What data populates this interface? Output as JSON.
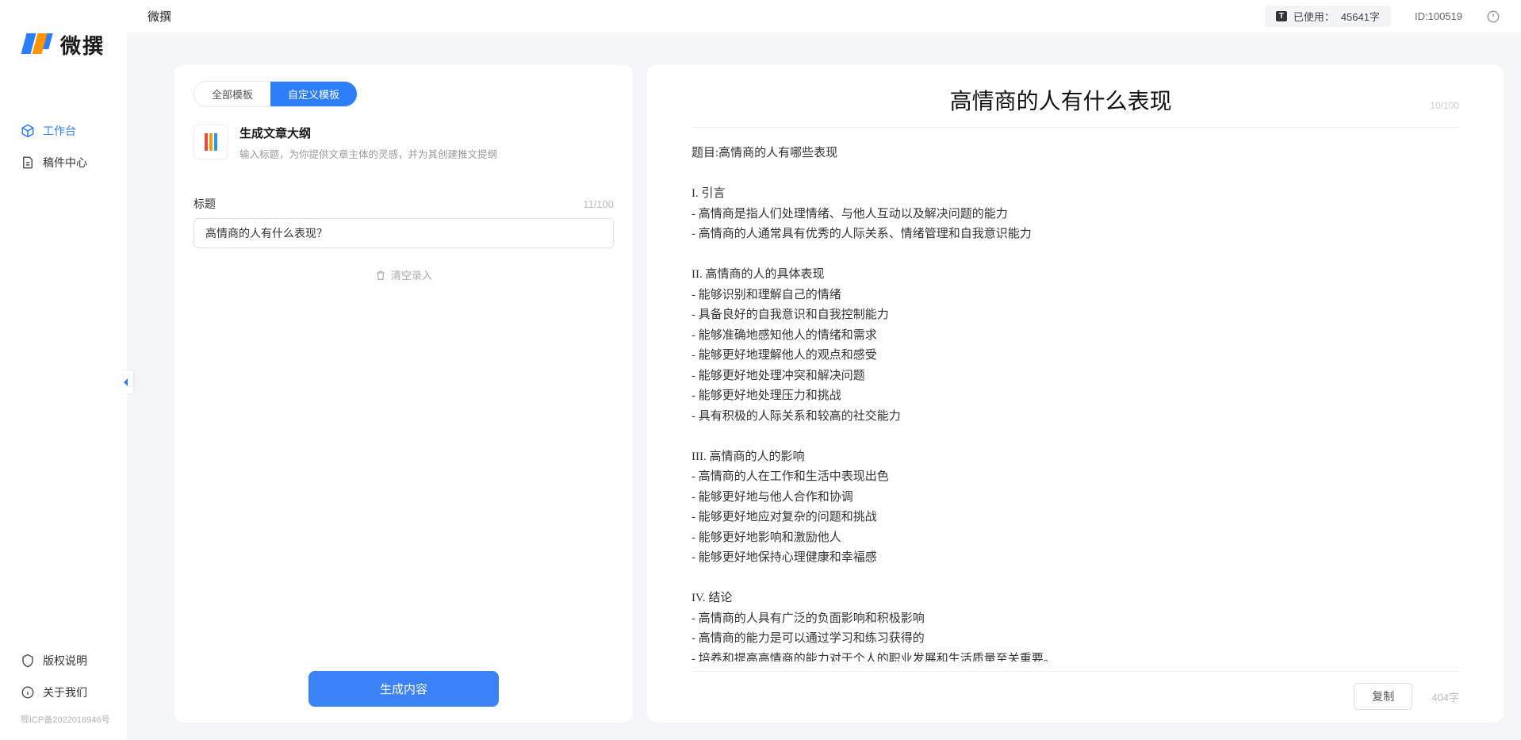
{
  "app": {
    "name": "微撰"
  },
  "logo": {
    "text": "微撰"
  },
  "sidebar": {
    "items": [
      {
        "label": "工作台",
        "active": true
      },
      {
        "label": "稿件中心",
        "active": false
      }
    ],
    "footer": [
      {
        "label": "版权说明"
      },
      {
        "label": "关于我们"
      }
    ],
    "icp": "鄂ICP备2022016946号"
  },
  "topbar": {
    "usage_prefix": "已使用：",
    "usage_value": "45641字",
    "id_prefix": "ID:",
    "id_value": "100519"
  },
  "tabs": {
    "all": "全部模板",
    "custom": "自定义模板"
  },
  "template": {
    "title": "生成文章大纲",
    "desc": "输入标题，为你提供文章主体的灵感，并为其创建推文提纲"
  },
  "form": {
    "title_label": "标题",
    "title_count": "11/100",
    "title_value": "高情商的人有什么表现？",
    "clear_label": "清空录入",
    "generate_label": "生成内容"
  },
  "output": {
    "title": "高情商的人有什么表现",
    "title_count": "10/100",
    "body": "题目:高情商的人有哪些表现\n\nI. 引言\n- 高情商是指人们处理情绪、与他人互动以及解决问题的能力\n- 高情商的人通常具有优秀的人际关系、情绪管理和自我意识能力\n\nII. 高情商的人的具体表现\n- 能够识别和理解自己的情绪\n- 具备良好的自我意识和自我控制能力\n- 能够准确地感知他人的情绪和需求\n- 能够更好地理解他人的观点和感受\n- 能够更好地处理冲突和解决问题\n- 能够更好地处理压力和挑战\n- 具有积极的人际关系和较高的社交能力\n\nIII. 高情商的人的影响\n- 高情商的人在工作和生活中表现出色\n- 能够更好地与他人合作和协调\n- 能够更好地应对复杂的问题和挑战\n- 能够更好地影响和激励他人\n- 能够更好地保持心理健康和幸福感\n\nIV. 结论\n- 高情商的人具有广泛的负面影响和积极影响\n- 高情商的能力是可以通过学习和练习获得的\n- 培养和提高高情商的能力对于个人的职业发展和生活质量至关重要。",
    "copy_label": "复制",
    "char_count": "404字"
  }
}
